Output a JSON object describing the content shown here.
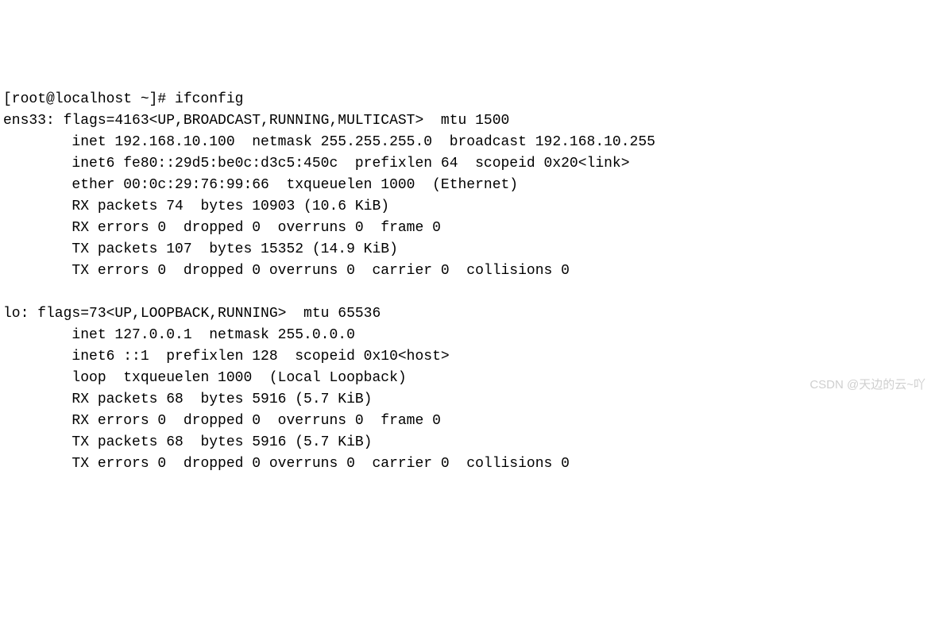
{
  "prompt": "[root@localhost ~]# ",
  "command": "ifconfig",
  "interfaces": [
    {
      "name": "ens33",
      "flags_line": "ens33: flags=4163<UP,BROADCAST,RUNNING,MULTICAST>  mtu 1500",
      "inet_line": "        inet 192.168.10.100  netmask 255.255.255.0  broadcast 192.168.10.255",
      "inet6_line": "        inet6 fe80::29d5:be0c:d3c5:450c  prefixlen 64  scopeid 0x20<link>",
      "link_line": "        ether 00:0c:29:76:99:66  txqueuelen 1000  (Ethernet)",
      "rx_packets_line": "        RX packets 74  bytes 10903 (10.6 KiB)",
      "rx_errors_line": "        RX errors 0  dropped 0  overruns 0  frame 0",
      "tx_packets_line": "        TX packets 107  bytes 15352 (14.9 KiB)",
      "tx_errors_line": "        TX errors 0  dropped 0 overruns 0  carrier 0  collisions 0"
    },
    {
      "name": "lo",
      "flags_line": "lo: flags=73<UP,LOOPBACK,RUNNING>  mtu 65536",
      "inet_line": "        inet 127.0.0.1  netmask 255.0.0.0",
      "inet6_line": "        inet6 ::1  prefixlen 128  scopeid 0x10<host>",
      "link_line": "        loop  txqueuelen 1000  (Local Loopback)",
      "rx_packets_line": "        RX packets 68  bytes 5916 (5.7 KiB)",
      "rx_errors_line": "        RX errors 0  dropped 0  overruns 0  frame 0",
      "tx_packets_line": "        TX packets 68  bytes 5916 (5.7 KiB)",
      "tx_errors_line": "        TX errors 0  dropped 0 overruns 0  carrier 0  collisions 0"
    }
  ],
  "blank": "",
  "watermark": "CSDN @天边的云~吖"
}
